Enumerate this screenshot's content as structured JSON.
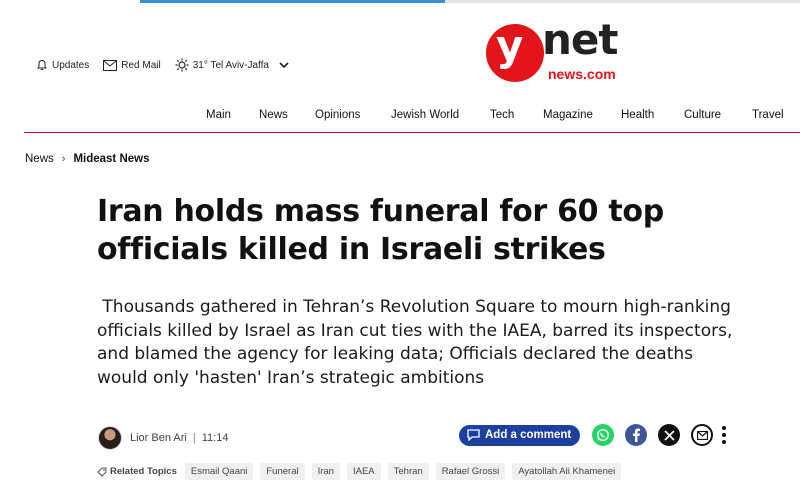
{
  "header": {
    "utility": {
      "updates_label": "Updates",
      "redmail_label": "Red Mail",
      "weather_label": "31° Tel Aviv-Jaffa"
    },
    "logo": {
      "y_text": "y",
      "net_text": "net",
      "news_text": "news.com"
    }
  },
  "nav": {
    "items": [
      "Main",
      "News",
      "Opinions",
      "Jewish World",
      "Tech",
      "Magazine",
      "Health",
      "Culture",
      "Travel"
    ]
  },
  "breadcrumb": {
    "home": "News",
    "current": "Mideast News"
  },
  "article": {
    "title": "Iran holds mass funeral for 60 top officials killed in Israeli strikes",
    "subtitle": " Thousands gathered in Tehran’s Revolution Square to mourn high-ranking officials killed by Israel as Iran cut ties with the IAEA, barred its inspectors, and blamed the agency for leaking data; Officials declared the deaths would only 'hasten' Iran’s strategic ambitions",
    "author": "Lior Ben Ari",
    "separator": "|",
    "time": "11:14",
    "comment_label": "Add a comment"
  },
  "share_icons": [
    "whatsapp-icon",
    "facebook-icon",
    "x-icon",
    "mail-icon",
    "more-icon"
  ],
  "colors": {
    "brand_red": "#e4141b",
    "comment_blue": "#1d3fa0",
    "whatsapp": "#25d366",
    "facebook": "#3b5998"
  },
  "related": {
    "label": "Related Topics",
    "tags": [
      "Esmail Qaani",
      "Funeral",
      "Iran",
      "IAEA",
      "Tehran",
      "Rafael Grossi",
      "Ayatollah Ali Khamenei"
    ]
  }
}
